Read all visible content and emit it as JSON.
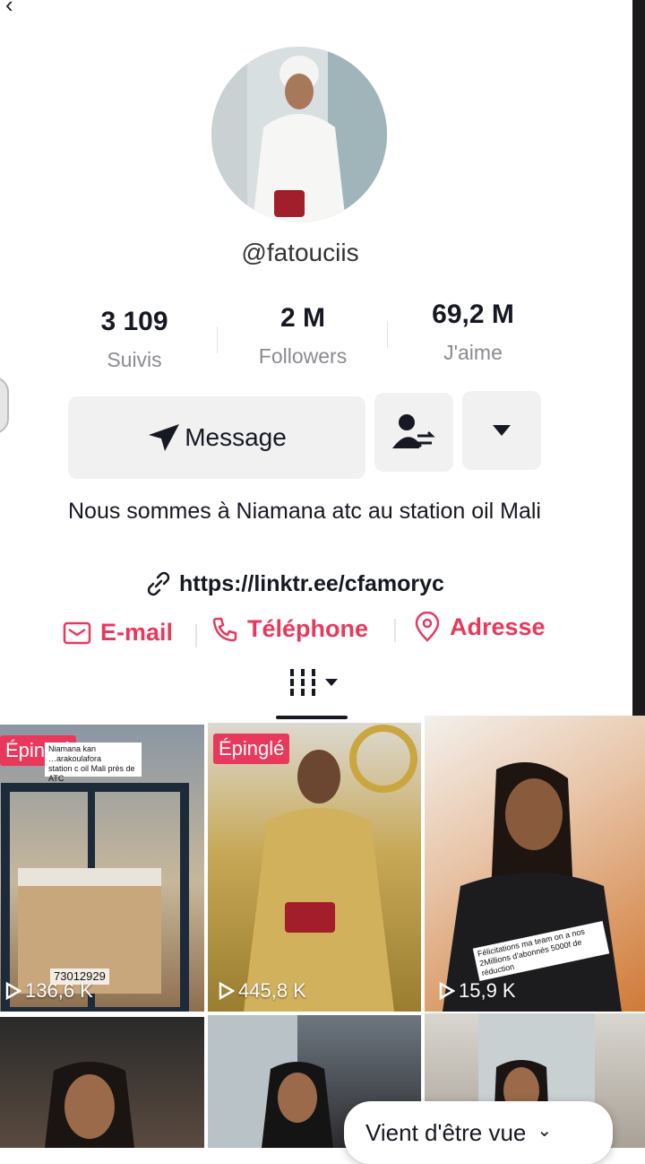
{
  "profile": {
    "handle": "@fatouciis",
    "stats": [
      {
        "value": "3 109",
        "label": "Suivis"
      },
      {
        "value": "2 M",
        "label": "Followers"
      },
      {
        "value": "69,2 M",
        "label": "J'aime"
      }
    ],
    "message_label": "Message",
    "bio": "Nous sommes à Niamana atc au station oil Mali",
    "link": "https://linktr.ee/cfamoryc",
    "contacts": {
      "email": "E-mail",
      "phone": "Téléphone",
      "address": "Adresse"
    }
  },
  "videos": [
    {
      "pinned_label": "Épinglé",
      "views": "136,6 K",
      "overlay_text": "73012929 "
    },
    {
      "pinned_label": "Épinglé",
      "views": "445,8 K"
    },
    {
      "views": "15,9 K",
      "overlay_text": "Félicitations ma team on a nos 2Millions d'abonnés 5000f de réduction"
    }
  ],
  "toast": {
    "label": "Vient d'être vue"
  },
  "colors": {
    "accent": "#e8395d",
    "text": "#161823",
    "muted": "#8a8b91"
  }
}
